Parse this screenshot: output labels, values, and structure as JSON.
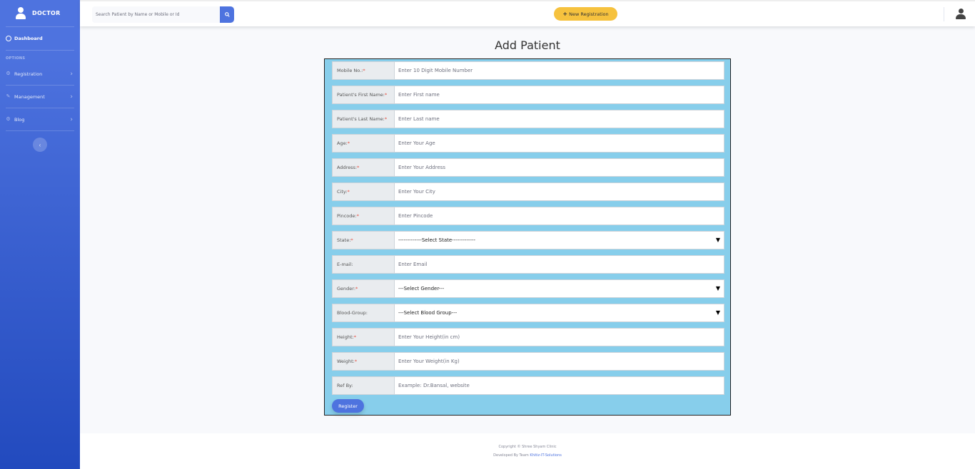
{
  "sidebar": {
    "brand": "DOCTOR",
    "dashboard": "Dashboard",
    "heading": "OPTIONS",
    "items": [
      {
        "label": "Registration",
        "icon": "gear-icon"
      },
      {
        "label": "Management",
        "icon": "wrench-icon"
      },
      {
        "label": "Blog",
        "icon": "gear-icon"
      }
    ]
  },
  "topbar": {
    "search_placeholder": "Search Patient by Name or Mobile or Id",
    "new_registration": "New Registration"
  },
  "form": {
    "title": "Add Patient",
    "fields": [
      {
        "label": "Mobile No.:",
        "required": true,
        "placeholder": "Enter 10 Digit Mobile Number"
      },
      {
        "label": "Patient's First Name:",
        "required": true,
        "placeholder": "Enter First name"
      },
      {
        "label": "Patient's Last Name:",
        "required": true,
        "placeholder": "Enter Last name"
      },
      {
        "label": "Age:",
        "required": true,
        "placeholder": "Enter Your Age"
      },
      {
        "label": "Address:",
        "required": true,
        "placeholder": "Enter Your Address"
      },
      {
        "label": "City:",
        "required": true,
        "placeholder": "Enter Your City"
      },
      {
        "label": "Pincode:",
        "required": true,
        "placeholder": "Enter Pincode"
      },
      {
        "label": "State:",
        "required": true,
        "select": "-------------Select State-------------"
      },
      {
        "label": "E-mail:",
        "required": false,
        "placeholder": "Enter Email"
      },
      {
        "label": "Gender:",
        "required": true,
        "select": "---Select Gender---"
      },
      {
        "label": "Blood-Group:",
        "required": false,
        "select": "---Select Blood Group---"
      },
      {
        "label": "Height:",
        "required": true,
        "placeholder": "Enter Your Height(in cm)"
      },
      {
        "label": "Weight:",
        "required": true,
        "placeholder": "Enter Your Weight(in Kg)"
      },
      {
        "label": "Ref By:",
        "required": false,
        "placeholder": "Example: Dr.Bansal, website"
      }
    ],
    "register_label": "Register"
  },
  "footer": {
    "copyright": "Copyright © Shree Shyam Clinic",
    "developed_by": "Developed By Team",
    "developer": "Khitiz-IT-Solutions"
  },
  "colors": {
    "sidebar_top": "#4e73df",
    "sidebar_bottom": "#224abe",
    "form_bg": "#87ceeb",
    "accent": "#4e73df",
    "warning": "#f6c23e",
    "required_star": "#e74a3b"
  }
}
